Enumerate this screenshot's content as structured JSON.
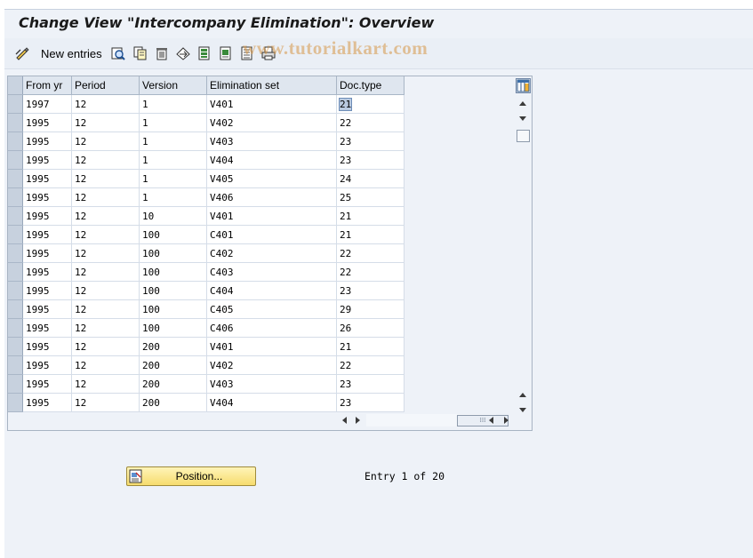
{
  "title": "Change View \"Intercompany Elimination\": Overview",
  "toolbar": {
    "new_entries_label": "New entries",
    "icons": [
      "change-display-icon",
      "details-icon",
      "copy-as-icon",
      "delete-icon",
      "undo-change-icon",
      "select-all-icon",
      "select-block-icon",
      "deselect-all-icon",
      "print-icon"
    ]
  },
  "watermark": "www.tutorialkart.com",
  "table": {
    "columns": [
      "From yr",
      "Period",
      "Version",
      "Elimination set",
      "Doc.type"
    ],
    "rows": [
      [
        "1997",
        "12",
        "1",
        "V401",
        "21"
      ],
      [
        "1995",
        "12",
        "1",
        "V402",
        "22"
      ],
      [
        "1995",
        "12",
        "1",
        "V403",
        "23"
      ],
      [
        "1995",
        "12",
        "1",
        "V404",
        "23"
      ],
      [
        "1995",
        "12",
        "1",
        "V405",
        "24"
      ],
      [
        "1995",
        "12",
        "1",
        "V406",
        "25"
      ],
      [
        "1995",
        "12",
        "10",
        "V401",
        "21"
      ],
      [
        "1995",
        "12",
        "100",
        "C401",
        "21"
      ],
      [
        "1995",
        "12",
        "100",
        "C402",
        "22"
      ],
      [
        "1995",
        "12",
        "100",
        "C403",
        "22"
      ],
      [
        "1995",
        "12",
        "100",
        "C404",
        "23"
      ],
      [
        "1995",
        "12",
        "100",
        "C405",
        "29"
      ],
      [
        "1995",
        "12",
        "100",
        "C406",
        "26"
      ],
      [
        "1995",
        "12",
        "200",
        "V401",
        "21"
      ],
      [
        "1995",
        "12",
        "200",
        "V402",
        "22"
      ],
      [
        "1995",
        "12",
        "200",
        "V403",
        "23"
      ],
      [
        "1995",
        "12",
        "200",
        "V404",
        "23"
      ]
    ]
  },
  "position_button": "Position...",
  "entry_info": "Entry 1 of 20",
  "colors": {
    "background": "#eef2f8",
    "header": "#dfe6ef",
    "button": "#f6dc6e"
  }
}
